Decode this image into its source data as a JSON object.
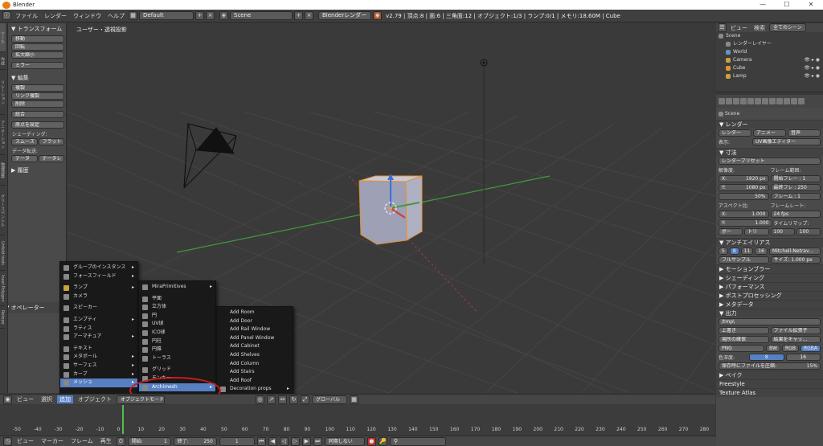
{
  "window": {
    "title": "Blender",
    "controls": [
      "—",
      "☐",
      "✕"
    ]
  },
  "topbar": {
    "menus": [
      "ファイル",
      "レンダー",
      "ウィンドウ",
      "ヘルプ"
    ],
    "layout": "Default",
    "scene": "Scene",
    "engine": "Blenderレンダー",
    "stats": "v2.79 | 頂点:8 | 面:6 | 三角面:12 | オブジェクト:1/3 | ランプ:0/1 | メモリ:18.60M | Cube"
  },
  "toolshelf": {
    "tabs": [
      "ツール",
      "作成",
      "リレーション",
      "アニメーション",
      "物理演算",
      "グリースペンシル",
      "Unfold tools",
      "Inset Polygon",
      "Retopo"
    ],
    "transform_header": "▼ トランスフォーム",
    "transform_buttons": [
      "移動",
      "回転",
      "拡大縮小"
    ],
    "mirror": "ミラー",
    "edit_header": "▼ 編集",
    "edit_buttons": [
      "複製",
      "リンク複製",
      "削除"
    ],
    "join": "統合",
    "origin": "原点を設定",
    "shading_label": "シェーディング:",
    "smooth": "スムーズ",
    "flat": "フラット",
    "data_transfer_label": "データ転送:",
    "data": "データ",
    "data_layers": "データレ",
    "history": "▶ 履歴",
    "operator": "▼ オペレーター"
  },
  "viewport": {
    "label": "ユーザー・透視投影"
  },
  "add_menu": {
    "items": [
      {
        "label": "グループのインスタンス",
        "arrow": "▸"
      },
      {
        "label": "フォースフィールド",
        "arrow": "▸"
      },
      {
        "label": "ランプ",
        "arrow": "▸"
      },
      {
        "label": "カメラ",
        "arrow": ""
      },
      {
        "label": "スピーカー",
        "arrow": ""
      },
      {
        "label": "エンプティ",
        "arrow": "▸"
      },
      {
        "label": "ラティス",
        "arrow": ""
      },
      {
        "label": "アーマチュア",
        "arrow": "▸"
      },
      {
        "label": "テキスト",
        "arrow": ""
      },
      {
        "label": "メタボール",
        "arrow": "▸"
      },
      {
        "label": "サーフェス",
        "arrow": "▸"
      },
      {
        "label": "カーブ",
        "arrow": "▸"
      },
      {
        "label": "メッシュ",
        "arrow": "▸"
      }
    ]
  },
  "mesh_menu": {
    "items": [
      {
        "label": "MiraPrimitives",
        "arrow": "▸"
      },
      {
        "label": "平面",
        "arrow": ""
      },
      {
        "label": "立方体",
        "arrow": ""
      },
      {
        "label": "円",
        "arrow": ""
      },
      {
        "label": "UV球",
        "arrow": ""
      },
      {
        "label": "ICO球",
        "arrow": ""
      },
      {
        "label": "円柱",
        "arrow": ""
      },
      {
        "label": "円錐",
        "arrow": ""
      },
      {
        "label": "トーラス",
        "arrow": ""
      },
      {
        "label": "グリッド",
        "arrow": ""
      },
      {
        "label": "モンキー",
        "arrow": ""
      },
      {
        "label": "Archimesh",
        "arrow": "▸"
      }
    ]
  },
  "archimesh_menu": {
    "items": [
      "Add Room",
      "Add Door",
      "Add Rail Window",
      "Add Panel Window",
      "Add Cabinet",
      "Add Shelves",
      "Add Column",
      "Add Stairs",
      "Add Roof",
      "Decoration props"
    ]
  },
  "view3d_header": {
    "menus": [
      "ビュー",
      "選択",
      "追加",
      "オブジェクト"
    ],
    "mode": "オブジェクトモード",
    "orientation": "グローバル"
  },
  "timeline": {
    "ticks": [
      "-50",
      "-40",
      "-30",
      "-20",
      "-10",
      "0",
      "10",
      "20",
      "30",
      "40",
      "50",
      "60",
      "70",
      "80",
      "90",
      "100",
      "110",
      "120",
      "130",
      "140",
      "150",
      "160",
      "170",
      "180",
      "190",
      "200",
      "210",
      "220",
      "230",
      "240",
      "250",
      "260",
      "270",
      "280"
    ]
  },
  "timeline_header": {
    "menus": [
      "ビュー",
      "マーカー",
      "フレーム",
      "再生"
    ],
    "start_label": "開始:",
    "start": "1",
    "end_label": "終了:",
    "end": "250",
    "current": "1",
    "sync": "同期しない"
  },
  "outliner": {
    "tabs": [
      "ビュー",
      "検索",
      "全てのシーン"
    ],
    "rows": [
      {
        "label": "Scene",
        "color": "#8a8a8a"
      },
      {
        "label": "レンダーレイヤー",
        "color": "#8a8a8a"
      },
      {
        "label": "World",
        "color": "#6b8fbf"
      },
      {
        "label": "Camera",
        "color": "#c9a23c"
      },
      {
        "label": "Cube",
        "color": "#e8902a"
      },
      {
        "label": "Lamp",
        "color": "#c9a23c"
      }
    ]
  },
  "properties": {
    "scene": "Scene",
    "render_header": "▼ レンダー",
    "render_btn": "レンダー",
    "anim_btn": "アニメー",
    "audio_btn": "音声",
    "display_label": "表示:",
    "display_value": "UV画像エディター",
    "dimensions_header": "▼ 寸法",
    "preset": "レンダープリセット",
    "resolution_label": "解像度:",
    "frame_range_label": "フレーム範囲:",
    "x_label": "X:",
    "x_val": "1920 px",
    "y_label": "Y:",
    "y_val": "1080 px",
    "percent": "50%",
    "start_frame": "開始フレー : 1",
    "end_frame": "最終フレ : 250",
    "frame_step": "フレーム : 1",
    "aspect_label": "アスペクト比:",
    "framerate_label": "フレームレート:",
    "ax_val": "1.000",
    "ay_val": "1.000",
    "fps": "24 fps",
    "time_remap": "タイムリマップ:",
    "border": "ボー",
    "crop": "トリ",
    "remap_old": "100",
    "remap_new": "100",
    "aa_header": "▼ アンチエイリアス",
    "aa_samples": [
      "5",
      "8",
      "11",
      "16"
    ],
    "aa_filter": "Mitchell-Netrav...",
    "full_sample": "フルサンプル",
    "size": "サイズ: 1.000 px",
    "sections": [
      "▶ モーションブラー",
      "▶ シェーディング",
      "▶ パフォーマンス",
      "▶ ポストプロセッシング",
      "▶ メタデータ"
    ],
    "output_header": "▼ 出力",
    "output_path": "/tmp\\",
    "overwrite": "上書き",
    "file_ext": "ファイル拡張子",
    "placeholders": "場所の確保",
    "cache": "結果をキャッ...",
    "format": "PNG",
    "bw": "BW",
    "rgb": "RGB",
    "rgba": "RGBA",
    "color_depth_label": "色深度:",
    "depth8": "8",
    "depth16": "16",
    "compress": "保存時にファイルを圧縮:",
    "compress_val": "15%",
    "bake_header": "▶ ベイク",
    "freestyle": "Freestyle",
    "texture_atlas": "Texture Atlas"
  },
  "colors": {
    "highlight": "#5680c2",
    "annotation": "#d01b1b",
    "cube": "#9ea0b5"
  }
}
